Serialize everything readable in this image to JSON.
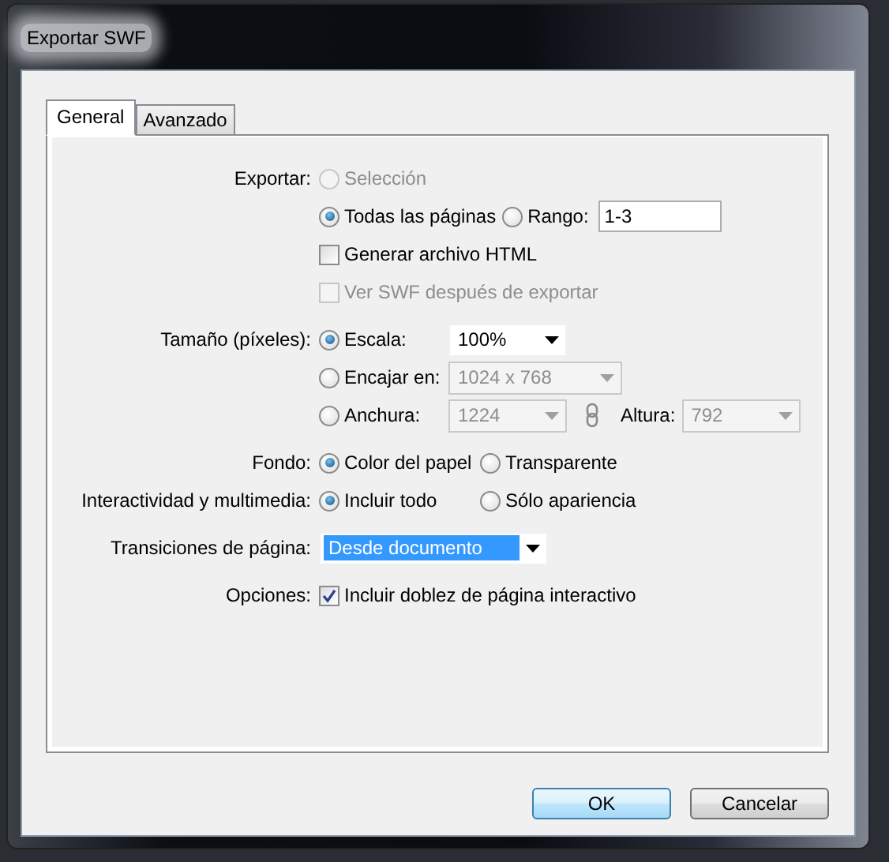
{
  "window": {
    "title": "Exportar SWF"
  },
  "tabs": [
    {
      "label": "General",
      "selected": true
    },
    {
      "label": "Avanzado",
      "selected": false
    }
  ],
  "sections": [
    {
      "rows": [
        {
          "label": "Exportar:",
          "controls": [
            {
              "kind": "radio",
              "label": "Selección",
              "selected": false,
              "disabled": true
            }
          ]
        },
        {
          "controls": [
            {
              "kind": "radio",
              "label": "Todas las páginas",
              "selected": true,
              "disabled": false
            },
            {
              "kind": "radio",
              "label": "Rango:",
              "selected": false,
              "disabled": false
            },
            {
              "kind": "text",
              "value": "1-3"
            }
          ]
        },
        {
          "controls": [
            {
              "kind": "checkbox",
              "label": "Generar archivo HTML",
              "checked": false,
              "disabled": false
            }
          ]
        },
        {
          "controls": [
            {
              "kind": "checkbox",
              "label": "Ver SWF después de exportar",
              "checked": false,
              "disabled": true
            }
          ]
        }
      ]
    },
    {
      "rows": [
        {
          "label": "Tamaño (píxeles):",
          "controls": [
            {
              "kind": "radio",
              "label": "Escala:",
              "selected": true,
              "disabled": false
            },
            {
              "kind": "dropdown",
              "value": "100%",
              "disabled": false,
              "highlighted": false
            }
          ]
        },
        {
          "controls": [
            {
              "kind": "radio",
              "label": "Encajar en:",
              "selected": false,
              "disabled": false
            },
            {
              "kind": "dropdown",
              "value": "1024 x 768",
              "disabled": true,
              "highlighted": false
            }
          ]
        },
        {
          "controls": [
            {
              "kind": "radio",
              "label": "Anchura:",
              "selected": false,
              "disabled": false
            },
            {
              "kind": "dropdown",
              "value": "1224",
              "disabled": true,
              "highlighted": false
            },
            {
              "kind": "link"
            },
            {
              "kind": "label",
              "label": "Altura:"
            },
            {
              "kind": "dropdown",
              "value": "792",
              "disabled": true,
              "highlighted": false
            }
          ]
        }
      ]
    },
    {
      "rows": [
        {
          "label": "Fondo:",
          "controls": [
            {
              "kind": "radio",
              "label": "Color del papel",
              "selected": true,
              "disabled": false
            },
            {
              "kind": "radio",
              "label": "Transparente",
              "selected": false,
              "disabled": false
            }
          ]
        },
        {
          "label": "Interactividad y multimedia:",
          "controls": [
            {
              "kind": "radio",
              "label": "Incluir todo",
              "selected": true,
              "disabled": false
            },
            {
              "kind": "radio",
              "label": "Sólo apariencia",
              "selected": false,
              "disabled": false
            }
          ]
        }
      ]
    },
    {
      "rows": [
        {
          "label": "Transiciones de página:",
          "controls": [
            {
              "kind": "dropdown",
              "value": "Desde documento",
              "disabled": false,
              "highlighted": true
            }
          ]
        }
      ]
    },
    {
      "rows": [
        {
          "label": "Opciones:",
          "controls": [
            {
              "kind": "checkbox",
              "label": "Incluir doblez de página interactivo",
              "checked": true,
              "disabled": false
            }
          ]
        }
      ]
    }
  ],
  "buttons": [
    {
      "label": "OK",
      "default": true
    },
    {
      "label": "Cancelar",
      "default": false
    }
  ]
}
